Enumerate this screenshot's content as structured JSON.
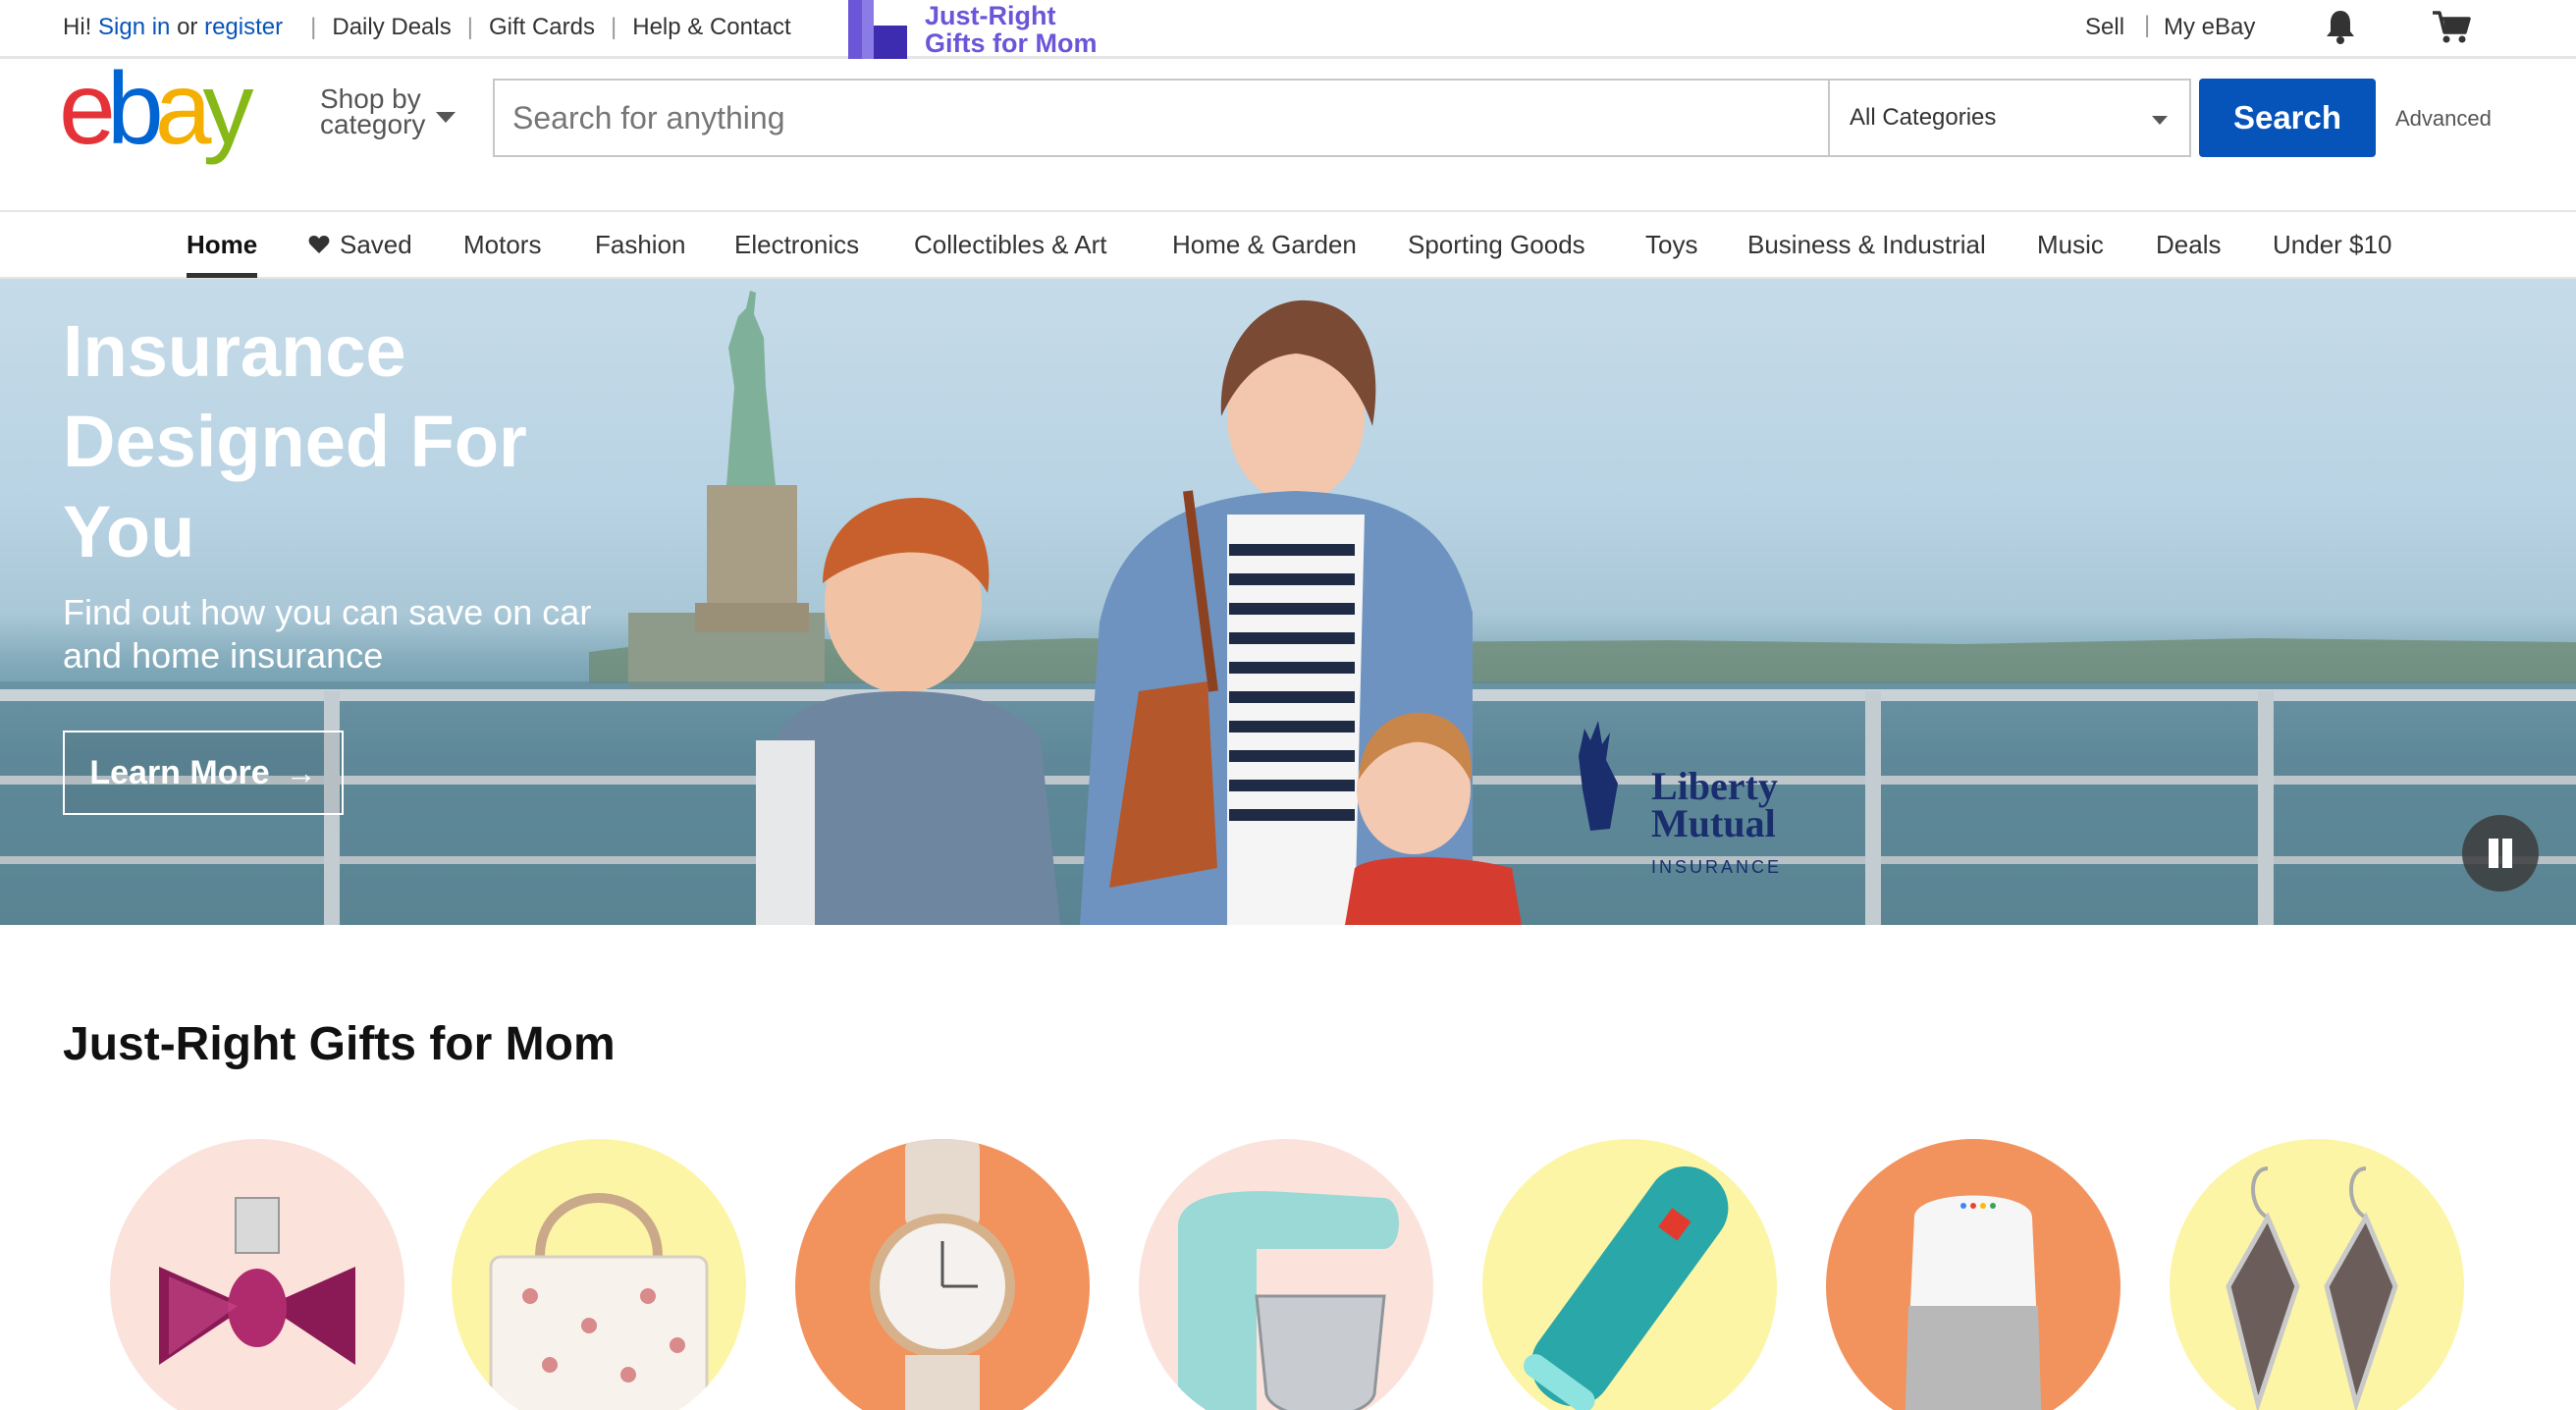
{
  "topbar": {
    "greeting": "Hi!",
    "sign_in": "Sign in",
    "or": "or",
    "register": "register",
    "links": [
      "Daily Deals",
      "Gift Cards",
      "Help & Contact"
    ],
    "promo_line1": "Just-Right",
    "promo_line2": "Gifts for Mom",
    "sell": "Sell",
    "my_ebay": "My eBay",
    "icons": [
      "bell-icon",
      "cart-icon"
    ]
  },
  "header": {
    "logo_text": "ebay",
    "shop_by_line1": "Shop by",
    "shop_by_line2": "category",
    "search_placeholder": "Search for anything",
    "category_selected": "All Categories",
    "search_button": "Search",
    "advanced": "Advanced"
  },
  "nav": {
    "items": [
      "Home",
      "Saved",
      "Motors",
      "Fashion",
      "Electronics",
      "Collectibles & Art",
      "Home & Garden",
      "Sporting Goods",
      "Toys",
      "Business & Industrial",
      "Music",
      "Deals",
      "Under $10"
    ],
    "active": "Home"
  },
  "hero": {
    "title_line1": "Insurance",
    "title_line2": "Designed For",
    "title_line3": "You",
    "subtitle_line1": "Find out how you can save on car",
    "subtitle_line2": "and home insurance",
    "cta": "Learn More",
    "sponsor_line1": "Liberty",
    "sponsor_line2": "Mutual",
    "sponsor_line3": "INSURANCE"
  },
  "gifts": {
    "title": "Just-Right Gifts for Mom",
    "items": [
      {
        "product": "perfume",
        "bg": "#fbe3dc"
      },
      {
        "product": "handbag",
        "bg": "#fdf5a6"
      },
      {
        "product": "watch",
        "bg": "#f2935e"
      },
      {
        "product": "stand-mixer",
        "bg": "#fbe3dc"
      },
      {
        "product": "bluetooth-speaker",
        "bg": "#fdf5a6"
      },
      {
        "product": "smart-speaker",
        "bg": "#f2935e"
      },
      {
        "product": "earrings",
        "bg": "#fdf5a6"
      }
    ]
  },
  "colors": {
    "link_blue": "#0654ba",
    "search_button": "#0654ba",
    "promo_purple": "#6b56d8",
    "logo_red": "#e53238",
    "logo_blue": "#0064d2",
    "logo_yellow": "#f5af02",
    "logo_green": "#86b817"
  }
}
